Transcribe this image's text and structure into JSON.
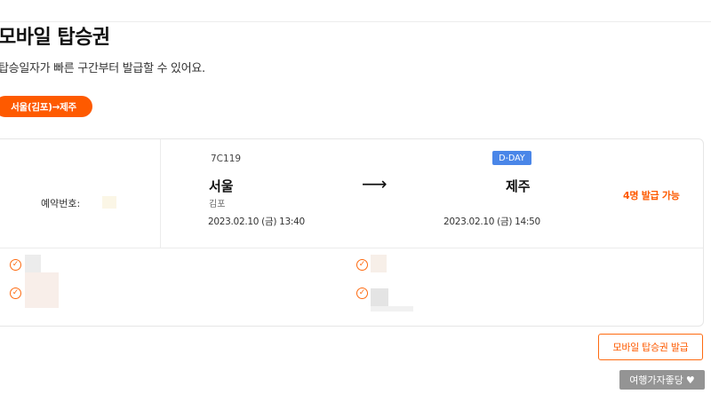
{
  "page": {
    "title": "모바일 탑승권",
    "subtitle": "탑승일자가 빠른 구간부터 발급할 수 있어요."
  },
  "route_chip": {
    "label": "서울(김포)→제주"
  },
  "booking": {
    "reservation_label": "예약번호:",
    "flight_number": "7C119",
    "dday_badge": "D-DAY",
    "departure": {
      "city": "서울",
      "airport": "김포",
      "datetime": "2023.02.10 (금) 13:40"
    },
    "arrival": {
      "city": "제주",
      "datetime": "2023.02.10 (금) 14:50"
    },
    "arrow": "⟶",
    "issue_availability": "4명 발급 가능"
  },
  "actions": {
    "issue_button": "모바일 탑승권 발급"
  },
  "watermark": {
    "text": "여행가자좋당"
  },
  "colors": {
    "accent": "#fe5a00",
    "badge": "#4a86e8",
    "border": "#e6e6e6"
  }
}
